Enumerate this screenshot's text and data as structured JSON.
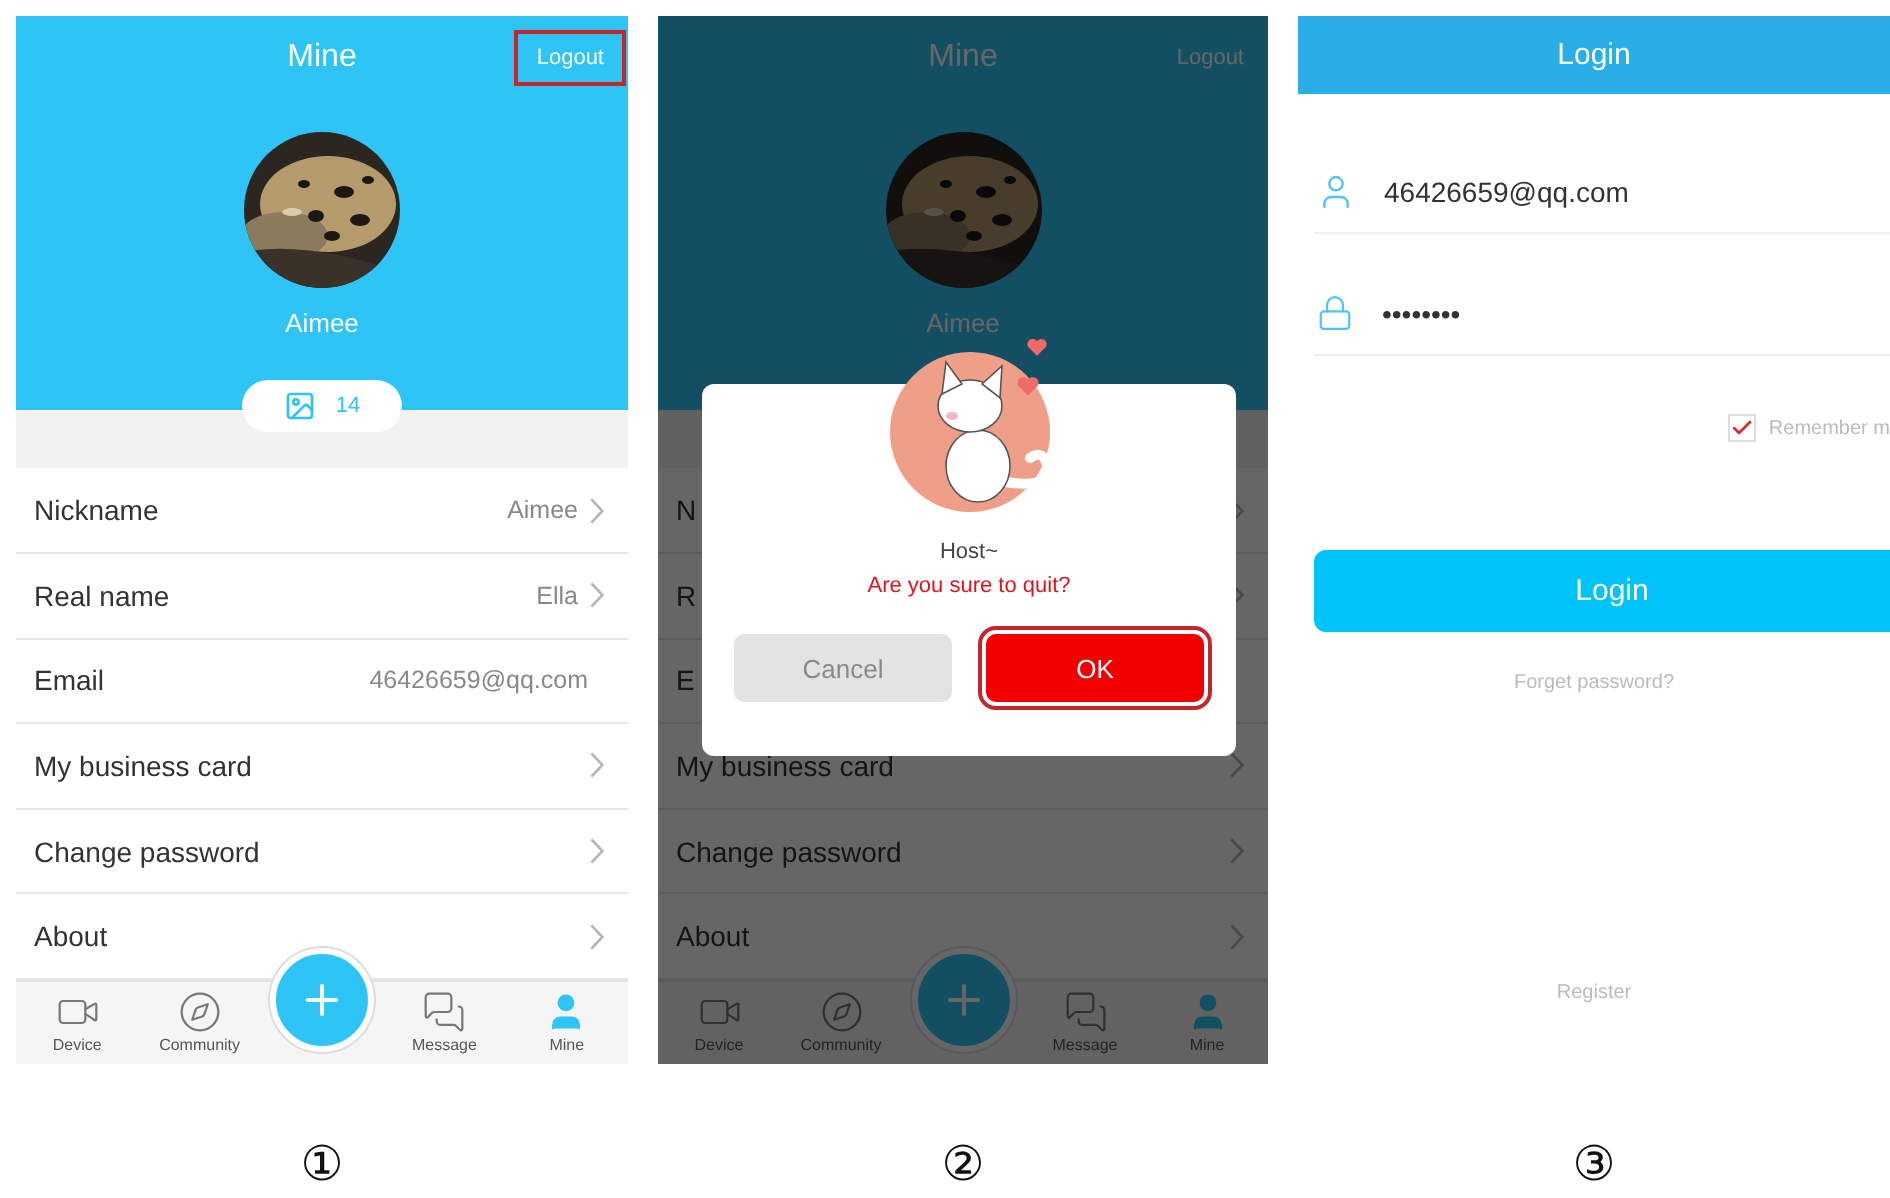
{
  "screens": [
    {
      "kind": "profile",
      "marker": "①",
      "dimmed": false,
      "title": "Mine",
      "logout": {
        "label": "Logout",
        "highlighted": true
      },
      "user_name": "Aimee",
      "photo_count": "14",
      "rows": [
        {
          "label": "Nickname",
          "value": "Aimee",
          "chevron": true
        },
        {
          "label": "Real name",
          "value": "Ella",
          "chevron": true
        },
        {
          "label": "Email",
          "value": "46426659@qq.com",
          "chevron": false
        },
        {
          "label": "My business card",
          "chevron": true
        },
        {
          "label": "Change password",
          "chevron": true
        },
        {
          "label": "About",
          "chevron": true
        }
      ],
      "nav": [
        {
          "kind": "tab",
          "label": "Device",
          "selected": false
        },
        {
          "kind": "tab",
          "label": "Community",
          "selected": false
        },
        {
          "kind": "add"
        },
        {
          "kind": "tab",
          "label": "Message",
          "selected": false
        },
        {
          "kind": "tab",
          "label": "Mine",
          "selected": true
        }
      ]
    },
    {
      "kind": "profile",
      "marker": "②",
      "dimmed": true,
      "title": "Mine",
      "logout": {
        "label": "Logout",
        "highlighted": false
      },
      "user_name": "Aimee",
      "rows": [
        {
          "label": "N",
          "chevron": true
        },
        {
          "label": "R",
          "chevron": true
        },
        {
          "label": "E",
          "chevron": false
        },
        {
          "label": "My business card",
          "chevron": true
        },
        {
          "label": "Change password",
          "chevron": true
        },
        {
          "label": "About",
          "chevron": true
        }
      ],
      "nav": [
        {
          "kind": "tab",
          "label": "Device",
          "selected": false
        },
        {
          "kind": "tab",
          "label": "Community",
          "selected": false
        },
        {
          "kind": "add"
        },
        {
          "kind": "tab",
          "label": "Message",
          "selected": false
        },
        {
          "kind": "tab",
          "label": "Mine",
          "selected": true
        }
      ],
      "dialog": {
        "greeting": "Host~",
        "message": "Are you sure to quit?",
        "cancel": {
          "label": "Cancel"
        },
        "ok": {
          "label": "OK",
          "highlighted": true
        }
      }
    },
    {
      "kind": "login",
      "marker": "③",
      "title": "Login",
      "email": "46426659@qq.com",
      "password": "••••••••",
      "remember": {
        "label": "Remember m",
        "checked": true
      },
      "login_button": "Login",
      "forgot": "Forget password?",
      "register": "Register"
    }
  ]
}
